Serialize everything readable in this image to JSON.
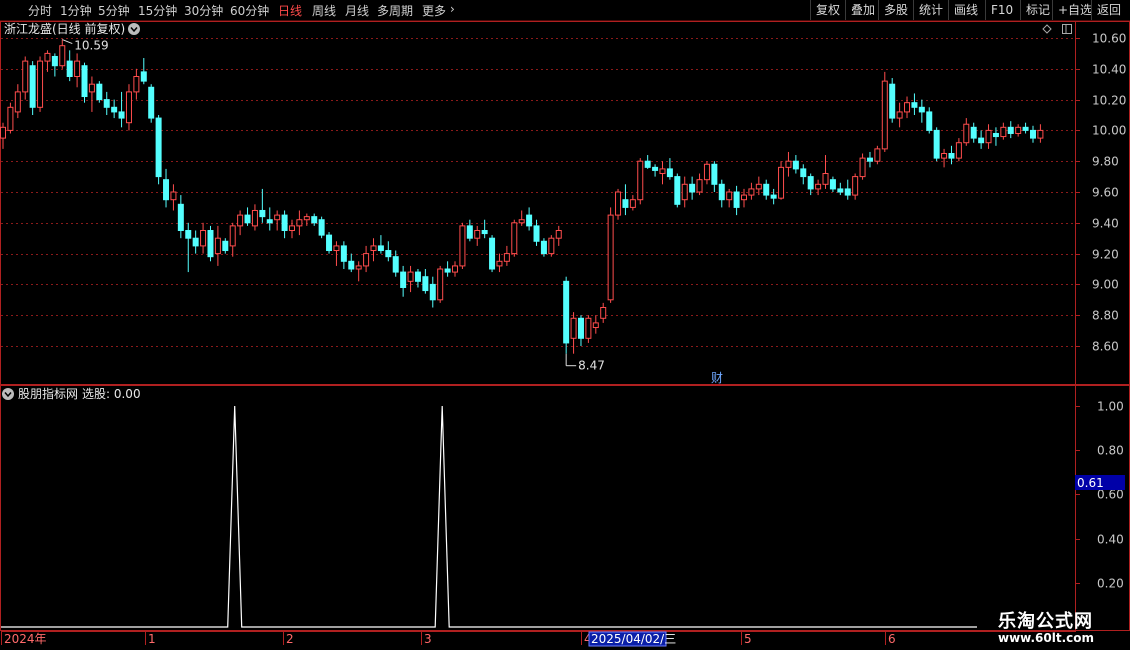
{
  "toolbar": {
    "periods": [
      "分时",
      "1分钟",
      "5分钟",
      "15分钟",
      "30分钟",
      "60分钟",
      "日线",
      "周线",
      "月线",
      "多周期",
      "更多"
    ],
    "active_period": "日线",
    "right_buttons": [
      "复权",
      "叠加",
      "多股",
      "统计",
      "画线",
      "F10",
      "标记",
      "+自选",
      "返回"
    ]
  },
  "stock": {
    "title": "浙江龙盛(日线 前复权)",
    "high_label": "10.59",
    "low_label": "8.47",
    "fin_marker": "财"
  },
  "indicator": {
    "title": "股朋指标网",
    "label": "选股: 0.00",
    "current_value": "0.61",
    "axis_ticks": [
      "1.00",
      "0.80",
      "0.60",
      "0.40",
      "0.20"
    ]
  },
  "date_axis": {
    "labels": [
      "2024年",
      "1",
      "2",
      "3",
      "4",
      "5",
      "6"
    ],
    "highlight": "2025/04/02/三"
  },
  "watermark": {
    "line1": "乐淘公式网",
    "line2": "www.60lt.com"
  },
  "colors": {
    "up": "#ff4d4d",
    "down": "#54ffff",
    "grid": "#8b1a1a",
    "frame": "#b02020",
    "signal": "#ffffff"
  },
  "chart_data": {
    "type": "candlestick",
    "price_axis": {
      "ticks": [
        10.6,
        10.4,
        10.2,
        10.0,
        9.8,
        9.6,
        9.4,
        9.2,
        9.0,
        8.8,
        8.6
      ],
      "ylim": [
        8.5,
        10.68
      ]
    },
    "candles_ohlc": [
      [
        9.95,
        10.05,
        9.88,
        10.02
      ],
      [
        10.0,
        10.18,
        9.98,
        10.15
      ],
      [
        10.12,
        10.3,
        10.08,
        10.25
      ],
      [
        10.25,
        10.48,
        10.2,
        10.45
      ],
      [
        10.42,
        10.45,
        10.1,
        10.15
      ],
      [
        10.15,
        10.48,
        10.12,
        10.45
      ],
      [
        10.45,
        10.52,
        10.38,
        10.5
      ],
      [
        10.48,
        10.5,
        10.35,
        10.42
      ],
      [
        10.42,
        10.59,
        10.4,
        10.55
      ],
      [
        10.45,
        10.52,
        10.32,
        10.35
      ],
      [
        10.35,
        10.5,
        10.28,
        10.45
      ],
      [
        10.42,
        10.44,
        10.18,
        10.22
      ],
      [
        10.25,
        10.35,
        10.12,
        10.3
      ],
      [
        10.3,
        10.32,
        10.18,
        10.2
      ],
      [
        10.2,
        10.25,
        10.1,
        10.15
      ],
      [
        10.15,
        10.2,
        10.08,
        10.12
      ],
      [
        10.12,
        10.25,
        10.02,
        10.08
      ],
      [
        10.05,
        10.3,
        10.0,
        10.25
      ],
      [
        10.25,
        10.4,
        10.2,
        10.35
      ],
      [
        10.38,
        10.47,
        10.3,
        10.32
      ],
      [
        10.28,
        10.3,
        10.05,
        10.08
      ],
      [
        10.08,
        10.1,
        9.65,
        9.7
      ],
      [
        9.68,
        9.75,
        9.5,
        9.55
      ],
      [
        9.55,
        9.65,
        9.48,
        9.6
      ],
      [
        9.52,
        9.58,
        9.3,
        9.35
      ],
      [
        9.35,
        9.4,
        9.08,
        9.3
      ],
      [
        9.3,
        9.35,
        9.2,
        9.25
      ],
      [
        9.25,
        9.4,
        9.2,
        9.35
      ],
      [
        9.35,
        9.38,
        9.15,
        9.18
      ],
      [
        9.2,
        9.38,
        9.12,
        9.3
      ],
      [
        9.28,
        9.3,
        9.2,
        9.22
      ],
      [
        9.25,
        9.4,
        9.18,
        9.38
      ],
      [
        9.38,
        9.48,
        9.32,
        9.45
      ],
      [
        9.45,
        9.5,
        9.38,
        9.4
      ],
      [
        9.38,
        9.52,
        9.35,
        9.48
      ],
      [
        9.48,
        9.62,
        9.4,
        9.44
      ],
      [
        9.42,
        9.5,
        9.35,
        9.4
      ],
      [
        9.42,
        9.48,
        9.35,
        9.45
      ],
      [
        9.45,
        9.48,
        9.3,
        9.35
      ],
      [
        9.35,
        9.42,
        9.3,
        9.38
      ],
      [
        9.38,
        9.48,
        9.32,
        9.42
      ],
      [
        9.42,
        9.46,
        9.38,
        9.44
      ],
      [
        9.44,
        9.46,
        9.38,
        9.4
      ],
      [
        9.42,
        9.44,
        9.3,
        9.32
      ],
      [
        9.32,
        9.34,
        9.2,
        9.22
      ],
      [
        9.22,
        9.28,
        9.12,
        9.25
      ],
      [
        9.25,
        9.28,
        9.1,
        9.15
      ],
      [
        9.15,
        9.2,
        9.08,
        9.1
      ],
      [
        9.1,
        9.15,
        9.02,
        9.12
      ],
      [
        9.12,
        9.25,
        9.08,
        9.2
      ],
      [
        9.22,
        9.3,
        9.15,
        9.25
      ],
      [
        9.25,
        9.32,
        9.2,
        9.22
      ],
      [
        9.22,
        9.28,
        9.15,
        9.18
      ],
      [
        9.18,
        9.22,
        9.05,
        9.08
      ],
      [
        9.08,
        9.12,
        8.92,
        8.98
      ],
      [
        9.02,
        9.12,
        8.95,
        9.08
      ],
      [
        9.08,
        9.1,
        8.98,
        9.02
      ],
      [
        9.05,
        9.1,
        8.94,
        8.96
      ],
      [
        9.0,
        9.05,
        8.85,
        8.9
      ],
      [
        8.9,
        9.12,
        8.88,
        9.1
      ],
      [
        9.1,
        9.15,
        9.05,
        9.08
      ],
      [
        9.08,
        9.15,
        9.05,
        9.12
      ],
      [
        9.12,
        9.4,
        9.1,
        9.38
      ],
      [
        9.38,
        9.42,
        9.28,
        9.3
      ],
      [
        9.3,
        9.38,
        9.25,
        9.35
      ],
      [
        9.35,
        9.42,
        9.3,
        9.33
      ],
      [
        9.3,
        9.32,
        9.08,
        9.1
      ],
      [
        9.12,
        9.2,
        9.08,
        9.15
      ],
      [
        9.15,
        9.25,
        9.12,
        9.2
      ],
      [
        9.2,
        9.42,
        9.18,
        9.4
      ],
      [
        9.4,
        9.48,
        9.38,
        9.42
      ],
      [
        9.45,
        9.5,
        9.35,
        9.38
      ],
      [
        9.38,
        9.42,
        9.25,
        9.28
      ],
      [
        9.28,
        9.3,
        9.18,
        9.2
      ],
      [
        9.2,
        9.32,
        9.18,
        9.3
      ],
      [
        9.3,
        9.38,
        9.25,
        9.35
      ],
      [
        9.02,
        9.05,
        8.55,
        8.62
      ],
      [
        8.65,
        8.82,
        8.55,
        8.78
      ],
      [
        8.78,
        8.8,
        8.6,
        8.65
      ],
      [
        8.65,
        8.8,
        8.62,
        8.78
      ],
      [
        8.72,
        8.8,
        8.68,
        8.75
      ],
      [
        8.78,
        8.88,
        8.75,
        8.85
      ],
      [
        8.9,
        9.5,
        8.88,
        9.45
      ],
      [
        9.45,
        9.62,
        9.42,
        9.6
      ],
      [
        9.55,
        9.65,
        9.45,
        9.5
      ],
      [
        9.5,
        9.58,
        9.48,
        9.55
      ],
      [
        9.55,
        9.82,
        9.52,
        9.8
      ],
      [
        9.8,
        9.84,
        9.75,
        9.76
      ],
      [
        9.76,
        9.78,
        9.7,
        9.74
      ],
      [
        9.72,
        9.8,
        9.65,
        9.75
      ],
      [
        9.75,
        9.82,
        9.68,
        9.7
      ],
      [
        9.7,
        9.72,
        9.5,
        9.52
      ],
      [
        9.55,
        9.7,
        9.5,
        9.65
      ],
      [
        9.65,
        9.7,
        9.55,
        9.6
      ],
      [
        9.6,
        9.72,
        9.58,
        9.68
      ],
      [
        9.68,
        9.8,
        9.65,
        9.78
      ],
      [
        9.78,
        9.8,
        9.6,
        9.65
      ],
      [
        9.65,
        9.68,
        9.5,
        9.55
      ],
      [
        9.55,
        9.62,
        9.5,
        9.6
      ],
      [
        9.6,
        9.64,
        9.45,
        9.5
      ],
      [
        9.55,
        9.62,
        9.5,
        9.58
      ],
      [
        9.58,
        9.66,
        9.55,
        9.62
      ],
      [
        9.62,
        9.7,
        9.58,
        9.65
      ],
      [
        9.65,
        9.68,
        9.55,
        9.58
      ],
      [
        9.58,
        9.62,
        9.52,
        9.56
      ],
      [
        9.56,
        9.8,
        9.55,
        9.76
      ],
      [
        9.76,
        9.86,
        9.7,
        9.8
      ],
      [
        9.8,
        9.84,
        9.72,
        9.75
      ],
      [
        9.75,
        9.78,
        9.65,
        9.7
      ],
      [
        9.7,
        9.72,
        9.58,
        9.62
      ],
      [
        9.62,
        9.68,
        9.58,
        9.65
      ],
      [
        9.65,
        9.84,
        9.62,
        9.72
      ],
      [
        9.68,
        9.7,
        9.6,
        9.62
      ],
      [
        9.62,
        9.66,
        9.58,
        9.6
      ],
      [
        9.62,
        9.68,
        9.55,
        9.58
      ],
      [
        9.58,
        9.72,
        9.55,
        9.7
      ],
      [
        9.7,
        9.85,
        9.68,
        9.82
      ],
      [
        9.82,
        9.86,
        9.76,
        9.8
      ],
      [
        9.8,
        9.9,
        9.78,
        9.88
      ],
      [
        9.88,
        10.38,
        9.86,
        10.32
      ],
      [
        10.3,
        10.34,
        10.05,
        10.08
      ],
      [
        10.08,
        10.18,
        10.02,
        10.12
      ],
      [
        10.12,
        10.22,
        10.08,
        10.18
      ],
      [
        10.18,
        10.24,
        10.1,
        10.15
      ],
      [
        10.15,
        10.2,
        10.05,
        10.12
      ],
      [
        10.12,
        10.15,
        9.98,
        10.0
      ],
      [
        10.0,
        10.02,
        9.8,
        9.82
      ],
      [
        9.82,
        9.88,
        9.76,
        9.85
      ],
      [
        9.85,
        9.9,
        9.78,
        9.82
      ],
      [
        9.82,
        9.95,
        9.8,
        9.92
      ],
      [
        9.92,
        10.08,
        9.9,
        10.04
      ],
      [
        10.02,
        10.05,
        9.92,
        9.95
      ],
      [
        9.95,
        10.0,
        9.88,
        9.92
      ],
      [
        9.92,
        10.04,
        9.88,
        10.0
      ],
      [
        9.98,
        10.02,
        9.9,
        9.96
      ],
      [
        9.96,
        10.05,
        9.94,
        10.02
      ],
      [
        10.02,
        10.06,
        9.95,
        9.98
      ],
      [
        9.98,
        10.04,
        9.96,
        10.02
      ],
      [
        10.02,
        10.05,
        9.98,
        10.0
      ],
      [
        10.0,
        10.03,
        9.92,
        9.95
      ],
      [
        9.95,
        10.04,
        9.92,
        10.0
      ]
    ],
    "indicator_series": {
      "name": "选股",
      "ylim": [
        0.0,
        1.05
      ],
      "spike_candle_indices": [
        31,
        59
      ]
    }
  }
}
